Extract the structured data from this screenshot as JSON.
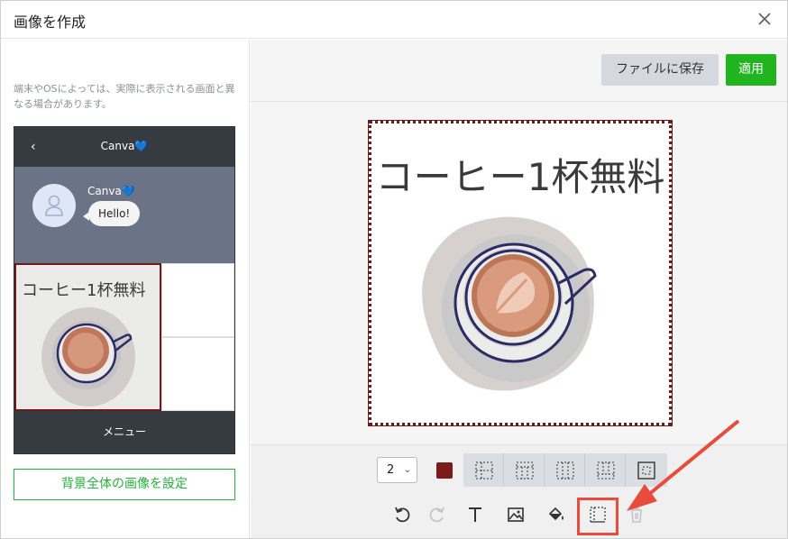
{
  "dialog": {
    "title": "画像を作成"
  },
  "preview": {
    "note": "端末やOSによっては、実際に表示される画面と異なる場合があります。",
    "back_glyph": "‹",
    "header_title": "Canva💙",
    "sender_name": "Canva💙",
    "message": "Hello!",
    "richmenu_text": "コーヒー1杯無料",
    "menu_label": "メニュー"
  },
  "left_panel": {
    "set_background_button": "背景全体の画像を設定"
  },
  "header_actions": {
    "save_file_label": "ファイルに保存",
    "apply_label": "適用"
  },
  "canvas": {
    "text": "コーヒー1杯無料"
  },
  "toolbar": {
    "line_width": "2",
    "line_color": "#7a1c1c",
    "grid_icons": [
      "grid-dotted-icon",
      "grid-top-icon",
      "grid-columns-icon",
      "grid-bottom-icon",
      "grid-center-icon"
    ],
    "tools": [
      "undo-icon",
      "redo-icon",
      "text-icon",
      "image-icon",
      "fill-icon",
      "border-icon",
      "trash-icon"
    ]
  },
  "colors": {
    "accent_green": "#20b41f",
    "annotation_red": "#e94b3c",
    "border_maroon": "#6b1b1b"
  }
}
